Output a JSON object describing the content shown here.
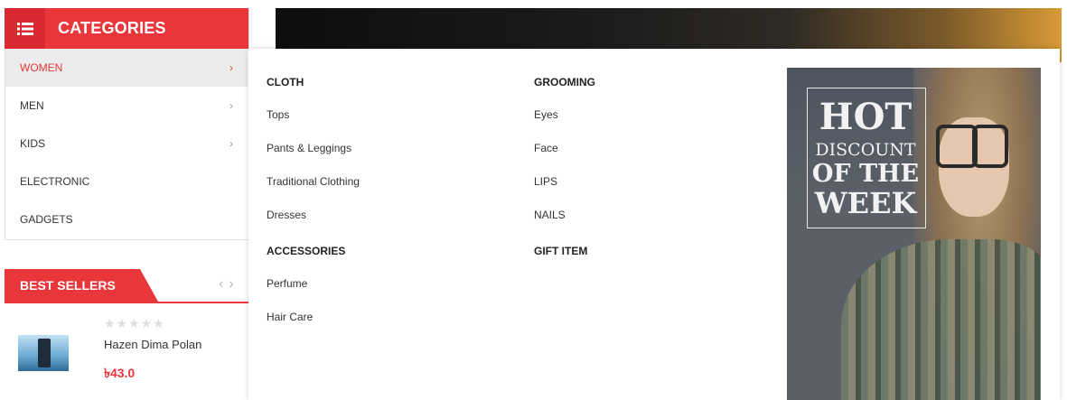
{
  "categories": {
    "title": "CATEGORIES",
    "items": [
      {
        "label": "WOMEN",
        "chevron": "›"
      },
      {
        "label": "MEN",
        "chevron": "›"
      },
      {
        "label": "KIDS",
        "chevron": "›"
      },
      {
        "label": "ELECTRONIC",
        "chevron": ""
      },
      {
        "label": "GADGETS",
        "chevron": ""
      }
    ],
    "active_index": 0
  },
  "mega_menu": {
    "columns": [
      {
        "groups": [
          {
            "heading": "CLOTH",
            "links": [
              "Tops",
              "Pants & Leggings",
              "Traditional Clothing",
              "Dresses"
            ]
          },
          {
            "heading": "ACCESSORIES",
            "links": [
              "Perfume",
              "Hair Care"
            ]
          }
        ]
      },
      {
        "groups": [
          {
            "heading": "GROOMING",
            "links": [
              "Eyes",
              "Face",
              "LIPS",
              "NAILS"
            ]
          },
          {
            "heading": "GIFT ITEM",
            "links": []
          }
        ]
      }
    ],
    "promo": {
      "line1": "HOT",
      "line2": "DISCOUNT",
      "line3": "OF THE",
      "line4": "WEEK"
    }
  },
  "best_sellers": {
    "title": "BEST SELLERS",
    "nav_prev": "‹",
    "nav_next": "›",
    "product": {
      "name": "Hazen Dima Polan",
      "price": "৳43.0",
      "rating": 0,
      "stars": "★★★★★"
    }
  },
  "colors": {
    "accent": "#e8363b"
  }
}
